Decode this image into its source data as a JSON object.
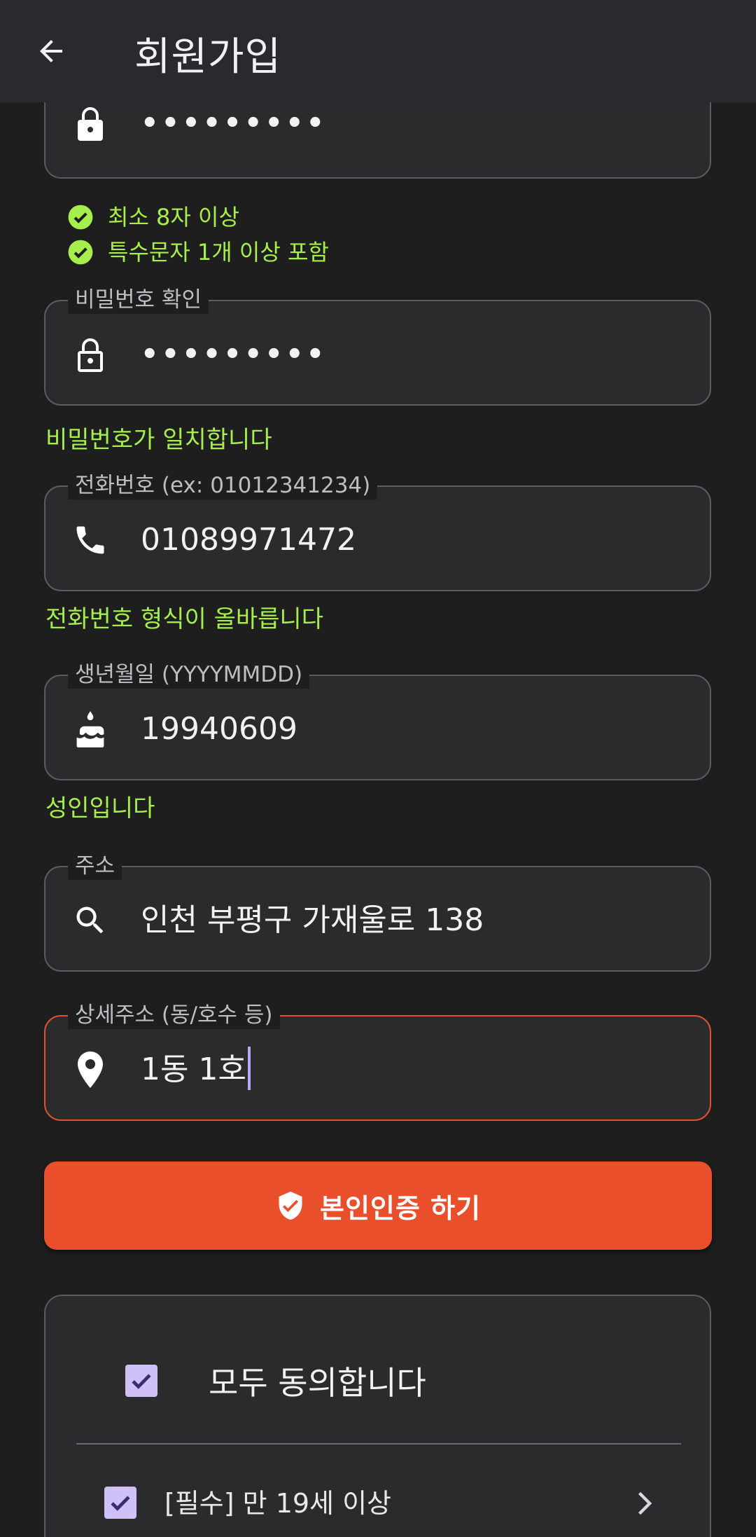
{
  "app_bar": {
    "title": "회원가입"
  },
  "password": {
    "masked_value": "•••••••••"
  },
  "password_rules": [
    {
      "text": "최소 8자 이상"
    },
    {
      "text": "특수문자 1개 이상 포함"
    }
  ],
  "password_confirm": {
    "label": "비밀번호 확인",
    "masked_value": "•••••••••",
    "helper": "비밀번호가 일치합니다"
  },
  "phone": {
    "label": "전화번호 (ex: 01012341234)",
    "value": "01089971472",
    "helper": "전화번호 형식이 올바릅니다"
  },
  "birth": {
    "label": "생년월일 (YYYYMMDD)",
    "value": "19940609",
    "helper": "성인입니다"
  },
  "address": {
    "label": "주소",
    "value": "인천 부평구 가재울로 138"
  },
  "address_detail": {
    "label": "상세주소 (동/호수 등)",
    "value": "1동 1호"
  },
  "verify_button": {
    "label": "본인인증 하기"
  },
  "agreements": {
    "agree_all_label": "모두 동의합니다",
    "items": [
      {
        "label": "[필수] 만 19세 이상",
        "checked": true
      }
    ]
  },
  "colors": {
    "accent": "#e94f2b",
    "success": "#a6ee4b",
    "checkbox": "#cfc0f7",
    "app_bar": "#2a2a2e",
    "background": "#1e1e1f"
  }
}
